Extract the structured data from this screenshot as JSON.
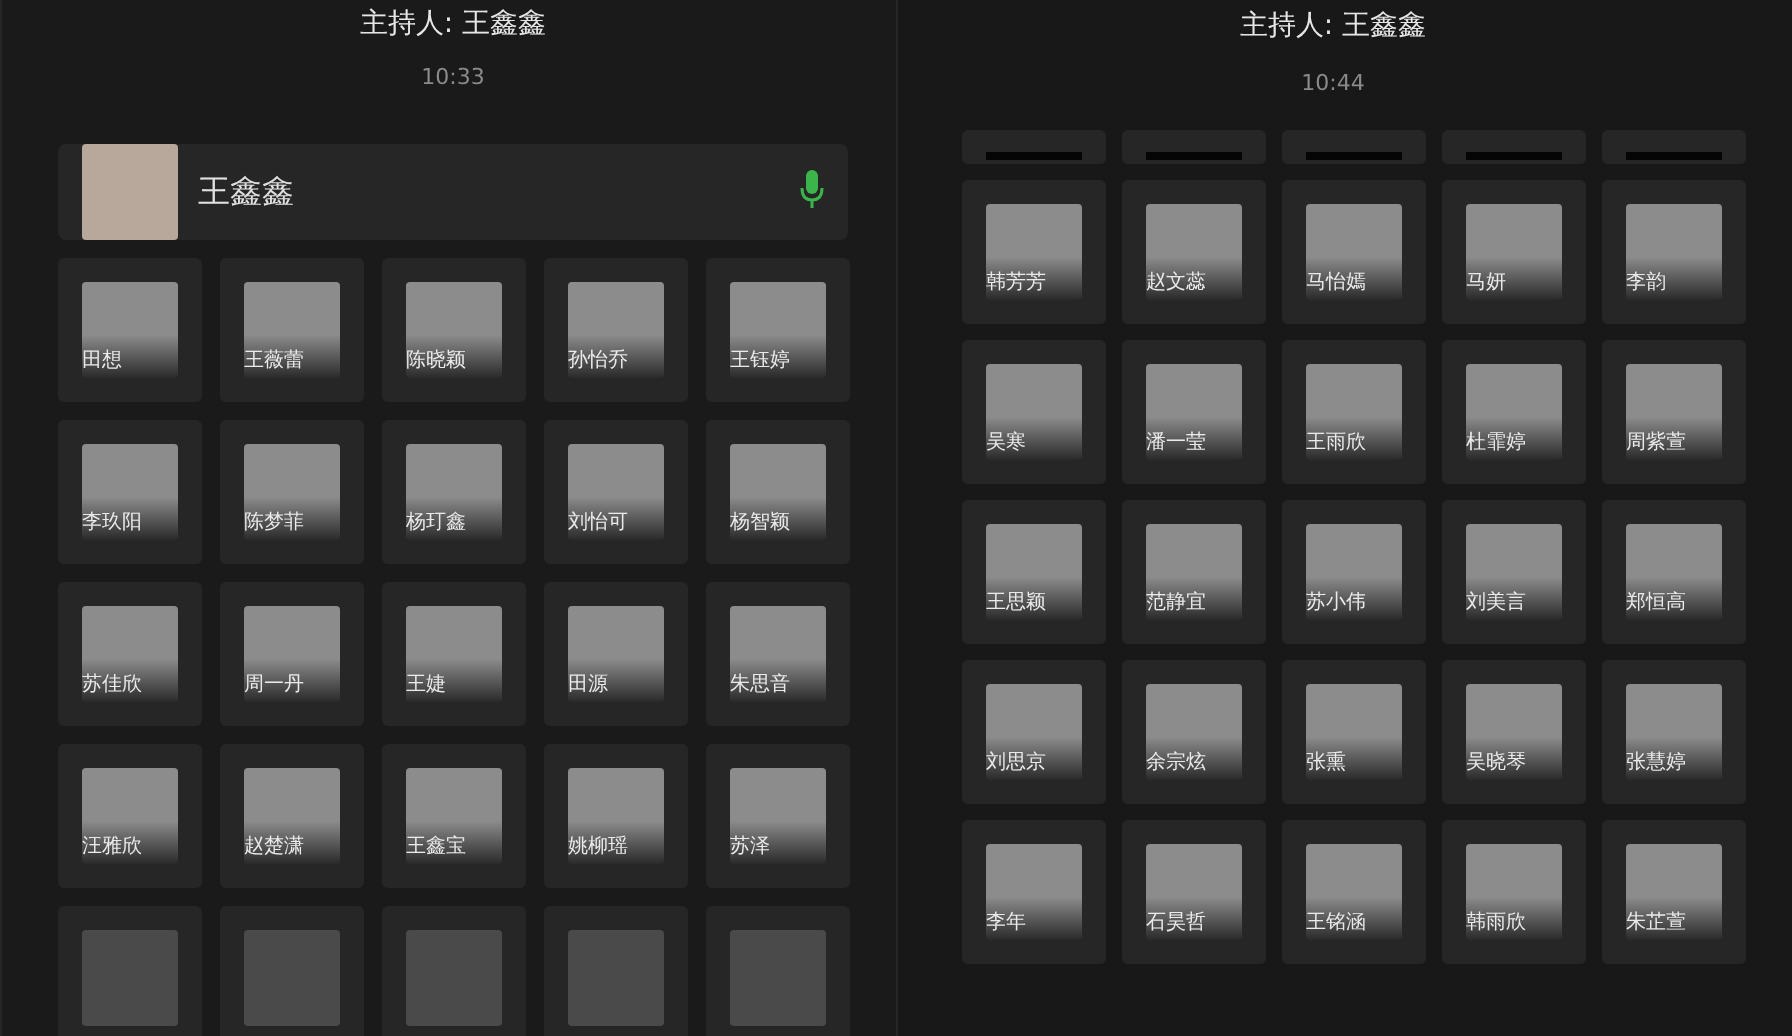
{
  "panels": [
    {
      "host_label": "主持人: 王鑫鑫",
      "time": "10:33",
      "host": {
        "name": "王鑫鑫",
        "mic_on": true
      },
      "participants": [
        {
          "kind": "tile",
          "name": "田想"
        },
        {
          "kind": "tile",
          "name": "王薇蕾"
        },
        {
          "kind": "tile",
          "name": "陈晓颖"
        },
        {
          "kind": "tile",
          "name": "孙怡乔"
        },
        {
          "kind": "tile",
          "name": "王钰婷"
        },
        {
          "kind": "tile",
          "name": "李玖阳"
        },
        {
          "kind": "tile",
          "name": "陈梦菲"
        },
        {
          "kind": "tile",
          "name": "杨玎鑫"
        },
        {
          "kind": "tile",
          "name": "刘怡可"
        },
        {
          "kind": "tile",
          "name": "杨智颖"
        },
        {
          "kind": "tile",
          "name": "苏佳欣"
        },
        {
          "kind": "tile",
          "name": "周一丹"
        },
        {
          "kind": "tile",
          "name": "王婕"
        },
        {
          "kind": "tile",
          "name": "田源"
        },
        {
          "kind": "tile",
          "name": "朱思音"
        },
        {
          "kind": "tile",
          "name": "汪雅欣"
        },
        {
          "kind": "tile",
          "name": "赵楚潇"
        },
        {
          "kind": "tile",
          "name": "王鑫宝"
        },
        {
          "kind": "tile",
          "name": "姚柳瑶"
        },
        {
          "kind": "tile",
          "name": "苏泽"
        },
        {
          "kind": "cut_bottom"
        },
        {
          "kind": "cut_bottom"
        },
        {
          "kind": "cut_bottom"
        },
        {
          "kind": "cut_bottom"
        },
        {
          "kind": "cut_bottom"
        }
      ]
    },
    {
      "host_label": "主持人: 王鑫鑫",
      "time": "10:44",
      "participants": [
        {
          "kind": "cut_top"
        },
        {
          "kind": "cut_top"
        },
        {
          "kind": "cut_top"
        },
        {
          "kind": "cut_top"
        },
        {
          "kind": "cut_top"
        },
        {
          "kind": "tile",
          "name": "韩芳芳"
        },
        {
          "kind": "tile",
          "name": "赵文蕊"
        },
        {
          "kind": "tile",
          "name": "马怡嫣"
        },
        {
          "kind": "tile",
          "name": "马妍"
        },
        {
          "kind": "tile",
          "name": "李韵"
        },
        {
          "kind": "tile",
          "name": "吴寒"
        },
        {
          "kind": "tile",
          "name": "潘一莹"
        },
        {
          "kind": "tile",
          "name": "王雨欣"
        },
        {
          "kind": "tile",
          "name": "杜霏婷"
        },
        {
          "kind": "tile",
          "name": "周紫萱"
        },
        {
          "kind": "tile",
          "name": "王思颖"
        },
        {
          "kind": "tile",
          "name": "范静宜"
        },
        {
          "kind": "tile",
          "name": "苏小伟"
        },
        {
          "kind": "tile",
          "name": "刘美言"
        },
        {
          "kind": "tile",
          "name": "郑恒高"
        },
        {
          "kind": "tile",
          "name": "刘思京"
        },
        {
          "kind": "tile",
          "name": "余宗炫"
        },
        {
          "kind": "tile",
          "name": "张熏"
        },
        {
          "kind": "tile",
          "name": "吴晓琴"
        },
        {
          "kind": "tile",
          "name": "张慧婷"
        },
        {
          "kind": "tile",
          "name": "李年"
        },
        {
          "kind": "tile",
          "name": "石昊哲"
        },
        {
          "kind": "tile",
          "name": "王铭涵"
        },
        {
          "kind": "tile",
          "name": "韩雨欣"
        },
        {
          "kind": "tile",
          "name": "朱芷萱"
        }
      ]
    }
  ]
}
